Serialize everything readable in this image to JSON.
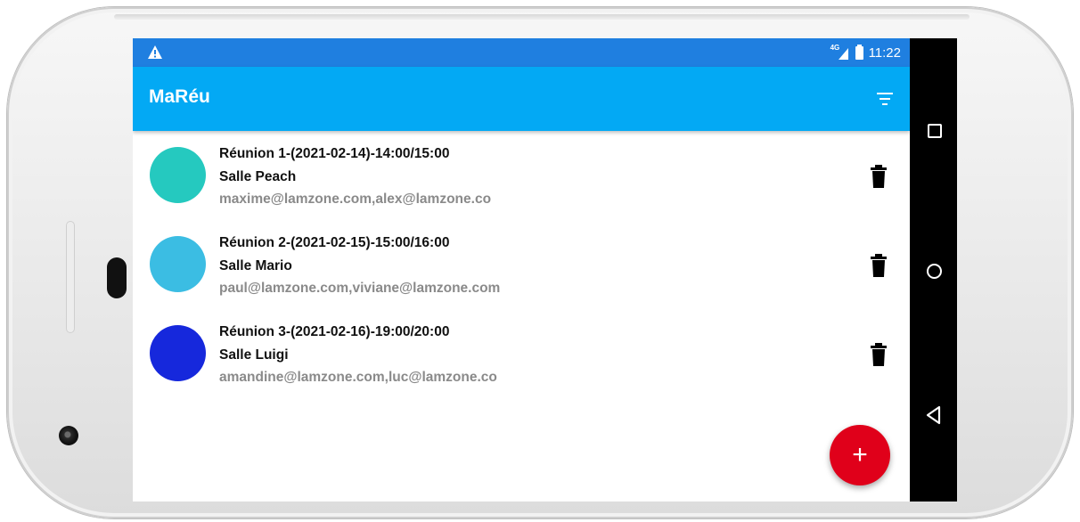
{
  "status_bar": {
    "network_type": "4G",
    "time": "11:22",
    "warning_icon": "warning-icon",
    "battery_icon": "battery-icon",
    "signal_icon": "signal-icon"
  },
  "toolbar": {
    "title": "MaRéu",
    "filter_icon": "filter-icon"
  },
  "meetings": [
    {
      "title": "Réunion 1-(2021-02-14)-14:00/15:00",
      "room": "Salle Peach",
      "participants": "maxime@lamzone.com,alex@lamzone.co",
      "color": "#25c9bf"
    },
    {
      "title": "Réunion 2-(2021-02-15)-15:00/16:00",
      "room": "Salle Mario",
      "participants": "paul@lamzone.com,viviane@lamzone.com",
      "color": "#3bbde3"
    },
    {
      "title": "Réunion 3-(2021-02-16)-19:00/20:00",
      "room": "Salle Luigi",
      "participants": "amandine@lamzone.com,luc@lamzone.co",
      "color": "#1628dc"
    }
  ],
  "fab": {
    "label": "+",
    "color": "#e0001a"
  },
  "colors": {
    "status_bar": "#1f7fe0",
    "toolbar": "#03a9f4",
    "nav_bar": "#000000"
  }
}
